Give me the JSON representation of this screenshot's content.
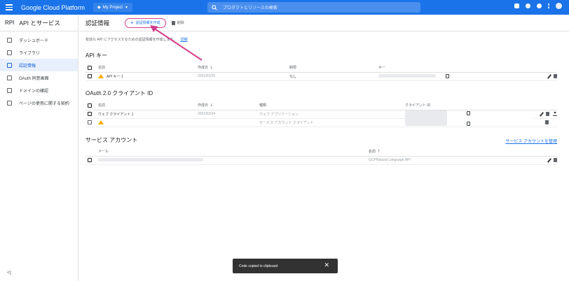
{
  "topbar": {
    "brand": "Google Cloud Platform",
    "project": "My Project",
    "search_placeholder": "プロダクトとリソースの検索"
  },
  "sidebar": {
    "api_badge": "RPI",
    "title": "API とサービス",
    "items": [
      {
        "label": "ダッシュボード",
        "icon": "dashboard-icon"
      },
      {
        "label": "ライブラリ",
        "icon": "library-icon"
      },
      {
        "label": "認証情報",
        "icon": "key-icon"
      },
      {
        "label": "OAuth 同意画面",
        "icon": "oauth-icon"
      },
      {
        "label": "ドメインの確認",
        "icon": "domain-icon"
      },
      {
        "label": "ページの使用に関する契約",
        "icon": "agreement-icon"
      }
    ],
    "collapse": "<|"
  },
  "actionbar": {
    "title": "認証情報",
    "create_label": "認証情報を作成",
    "delete_label": "削除"
  },
  "description": {
    "text": "有効な API にアクセスするための認証情報を作成します。",
    "link": "詳細"
  },
  "api_keys": {
    "title": "API キー",
    "headers": [
      "名前",
      "作成日",
      "制限",
      "キー"
    ],
    "rows": [
      {
        "name": "API キー 1",
        "created": "2021/03/20",
        "restriction": "なし"
      }
    ]
  },
  "oauth": {
    "title": "OAuth 2.0 クライアント ID",
    "headers": [
      "名前",
      "作成日",
      "種類",
      "クライアント ID"
    ],
    "rows": [
      {
        "name": "ウェブ クライアント 1",
        "created": "2021/03/24",
        "type": "ウェブ アプリケーション"
      },
      {
        "name": "",
        "created": "",
        "type": "サービス アカウント クライアント"
      }
    ]
  },
  "service_accounts": {
    "title": "サービス アカウント",
    "manage_link": "サービス アカウントを管理",
    "headers": [
      "メール",
      "名前"
    ],
    "rows": [
      {
        "name": "GCPNatural Language API"
      }
    ]
  },
  "snackbar": {
    "message": "Code copied to clipboard",
    "close": "✕"
  },
  "colors": {
    "topbar": "#1a73e8",
    "accent": "#1a73e8",
    "annotation": "#d23f8e",
    "warning": "#f9ab00"
  }
}
